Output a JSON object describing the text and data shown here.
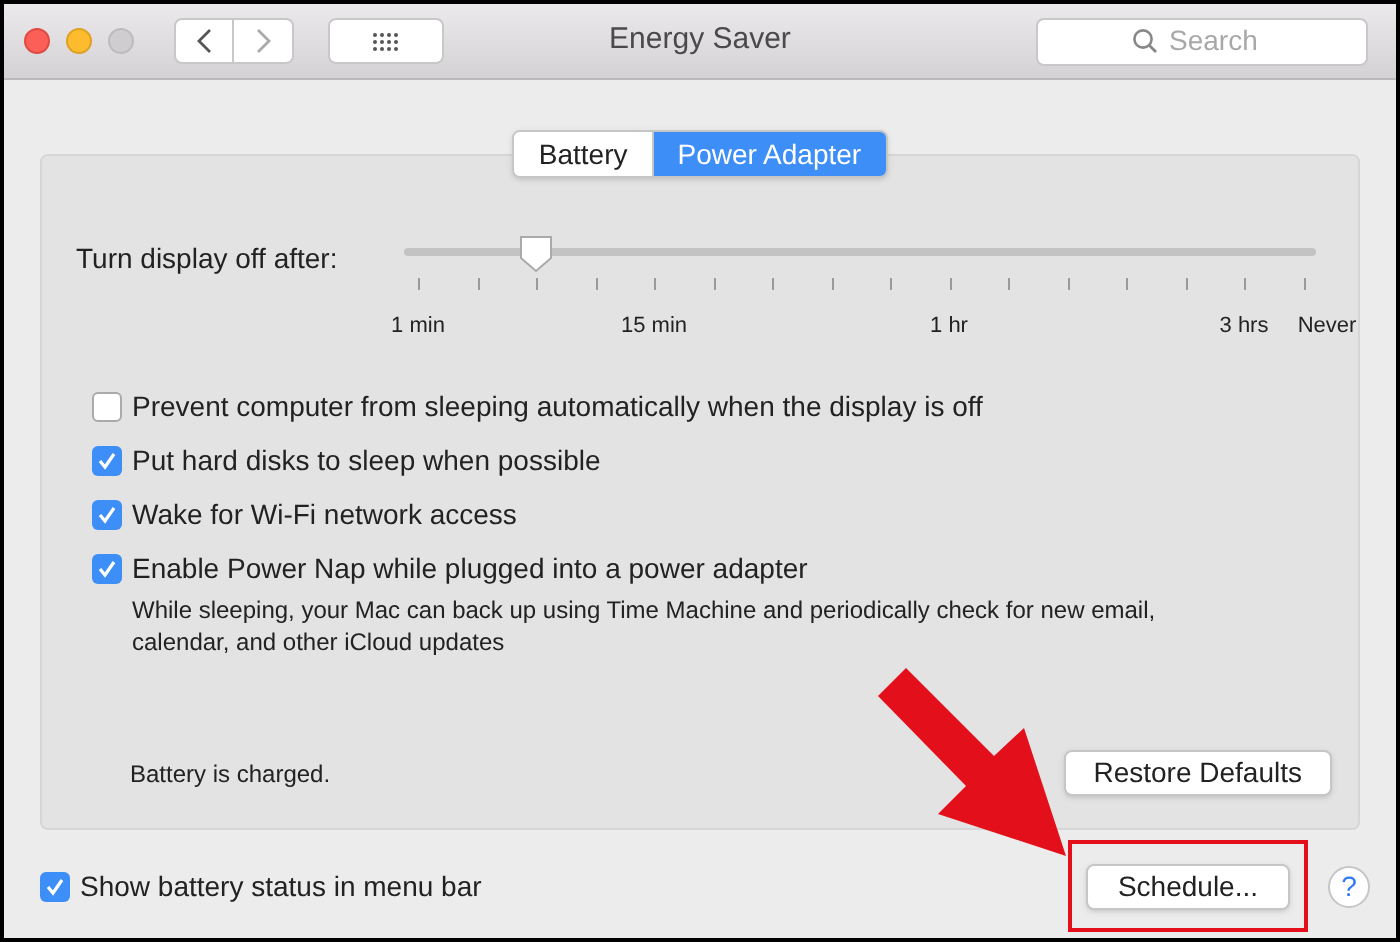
{
  "window": {
    "title": "Energy Saver"
  },
  "search": {
    "placeholder": "Search"
  },
  "tabs": [
    {
      "label": "Battery",
      "selected": false
    },
    {
      "label": "Power Adapter",
      "selected": true
    }
  ],
  "display_sleep": {
    "label": "Turn display off after:",
    "level": 0.145,
    "tick_labels": [
      "1 min",
      "15 min",
      "1 hr",
      "3 hrs",
      "Never"
    ]
  },
  "options": [
    {
      "label": "Prevent computer from sleeping automatically when the display is off",
      "checked": false
    },
    {
      "label": "Put hard disks to sleep when possible",
      "checked": true
    },
    {
      "label": "Wake for Wi-Fi network access",
      "checked": true
    },
    {
      "label": "Enable Power Nap while plugged into a power adapter",
      "checked": true,
      "description": "While sleeping, your Mac can back up using Time Machine and periodically check for new email, calendar, and other iCloud updates"
    }
  ],
  "battery_status": "Battery is charged.",
  "restore_button": "Restore Defaults",
  "show_battery_status": {
    "label": "Show battery status in menu bar",
    "checked": true
  },
  "schedule_button": "Schedule...",
  "help_button": "?"
}
